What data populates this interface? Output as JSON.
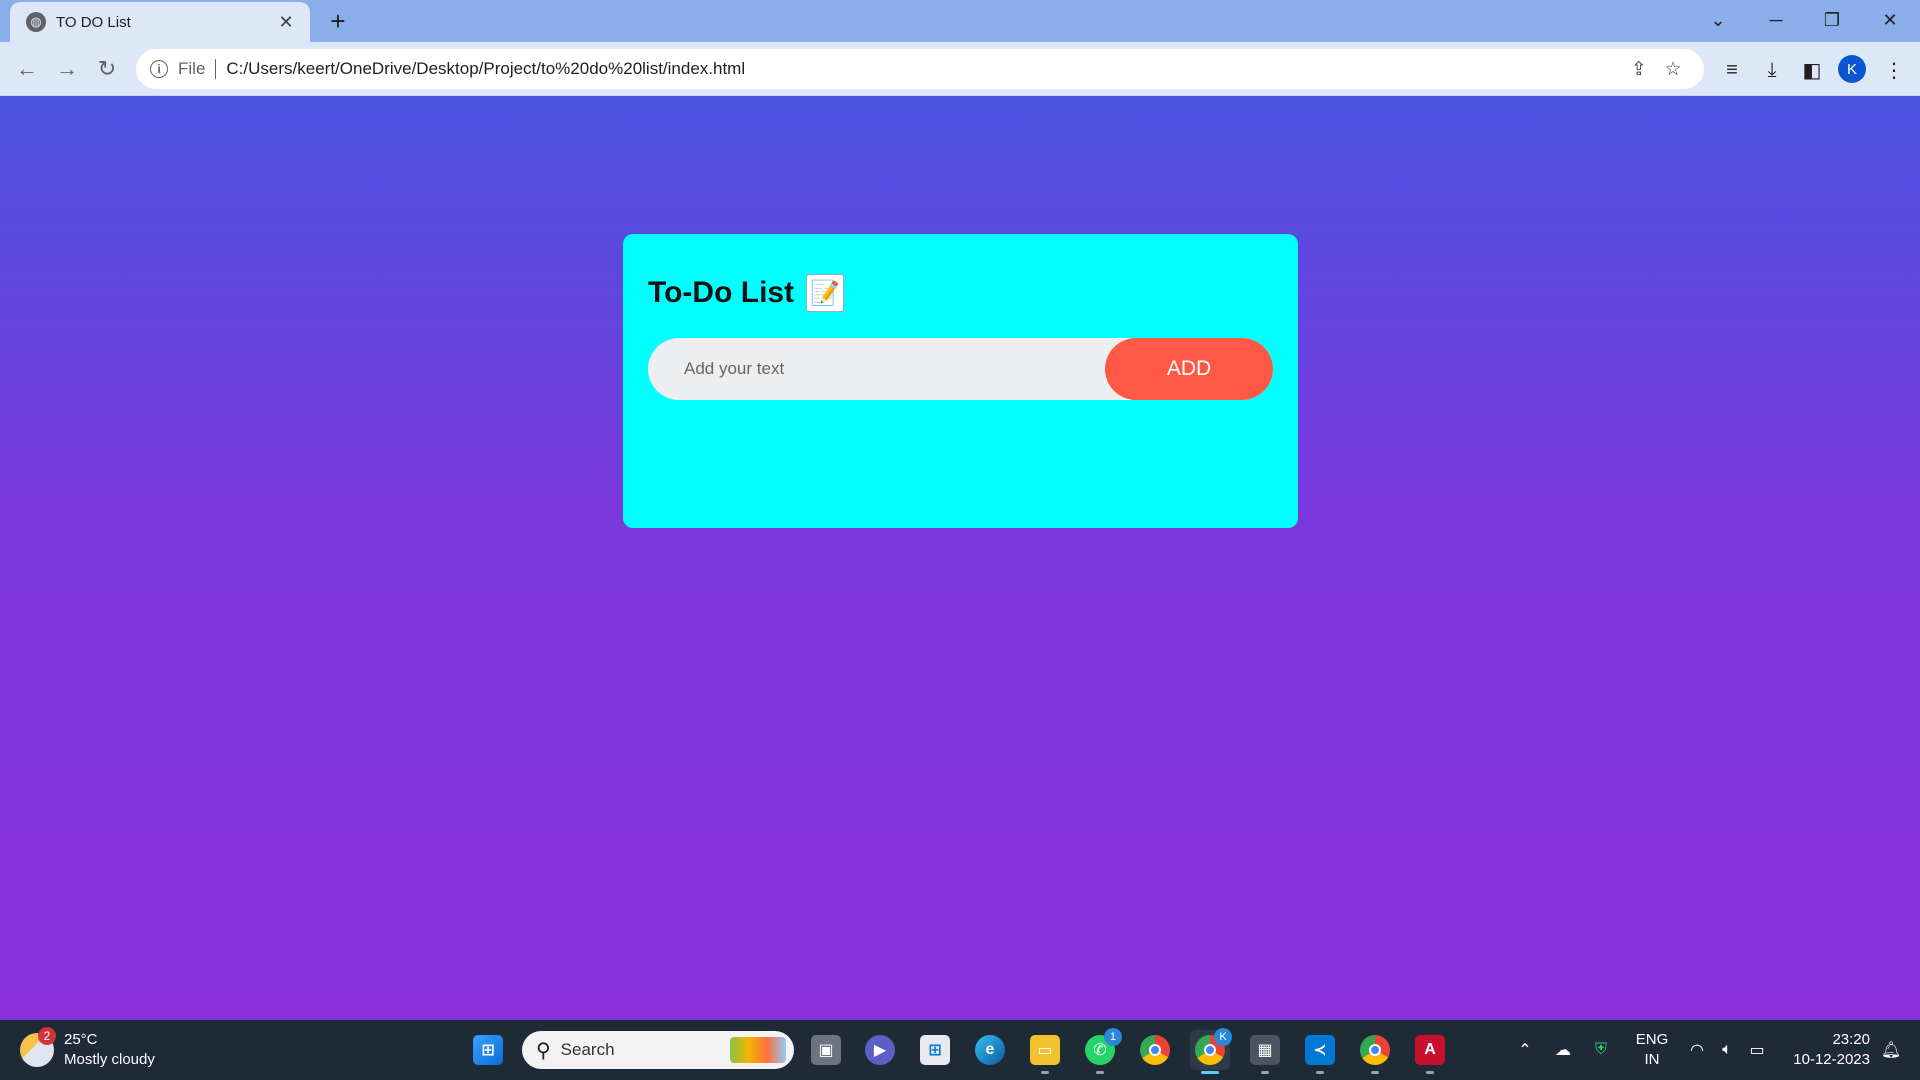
{
  "browser": {
    "tab_title": "TO DO List",
    "url_scheme": "File",
    "url": "C:/Users/keert/OneDrive/Desktop/Project/to%20do%20list/index.html",
    "profile_initial": "K"
  },
  "app": {
    "heading": "To-Do List",
    "heading_icon": "📝",
    "input_placeholder": "Add your text",
    "add_label": "ADD",
    "colors": {
      "card": "#00ffff",
      "button": "#ff5945",
      "background_top": "#4a52e0",
      "background_bottom": "#8a2fdd"
    }
  },
  "taskbar": {
    "weather": {
      "temp": "25°C",
      "condition": "Mostly cloudy",
      "badge": "2"
    },
    "search_label": "Search",
    "whatsapp_badge": "1",
    "chrome_profile_badge": "K",
    "lang_line1": "ENG",
    "lang_line2": "IN",
    "time": "23:20",
    "date": "10-12-2023"
  }
}
